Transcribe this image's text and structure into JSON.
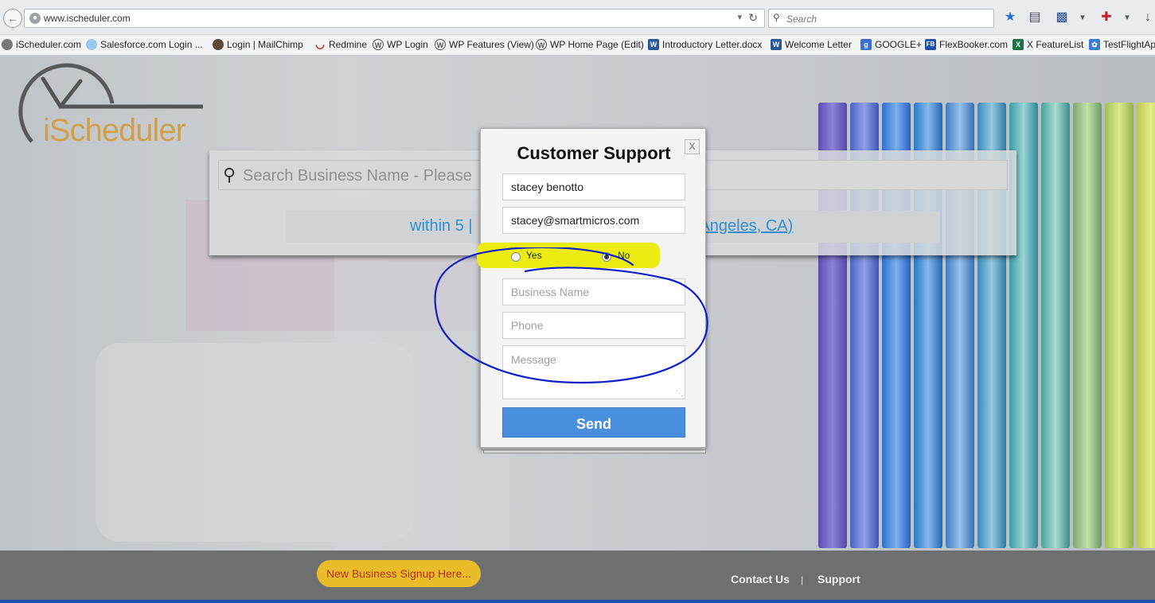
{
  "browser": {
    "url": "www.ischeduler.com",
    "search_placeholder": "Search",
    "bookmarks": [
      {
        "label": "iScheduler.com",
        "icon": "clock-icon"
      },
      {
        "label": "Salesforce.com Login ...",
        "icon": "cloud-icon"
      },
      {
        "label": "Login | MailChimp",
        "icon": "chimp-icon"
      },
      {
        "label": "Redmine",
        "icon": "redmine-icon"
      },
      {
        "label": "WP Login",
        "icon": "wordpress-icon"
      },
      {
        "label": "WP Features (View)",
        "icon": "wordpress-icon"
      },
      {
        "label": "WP Home Page (Edit)",
        "icon": "wordpress-icon"
      },
      {
        "label": "Introductory Letter.docx",
        "icon": "word-icon"
      },
      {
        "label": "Welcome Letter",
        "icon": "word-icon"
      },
      {
        "label": "GOOGLE+",
        "icon": "google-icon"
      },
      {
        "label": "FlexBooker.com",
        "icon": "flexbooker-icon"
      },
      {
        "label": "X FeatureList",
        "icon": "excel-icon"
      },
      {
        "label": "TestFlightAp",
        "icon": "testflight-icon"
      }
    ]
  },
  "site": {
    "logo_text": "iScheduler",
    "search_placeholder": "Search Business Name - Please",
    "radius_text": "within 5 |",
    "location_text": "s Angeles, CA)",
    "footer": {
      "signup_label": "New Business Signup Here...",
      "contact_label": "Contact Us",
      "separator": "|",
      "support_label": "Support"
    }
  },
  "modal": {
    "title": "Customer Support",
    "close_label": "X",
    "name_value": "stacey benotto",
    "email_value": "stacey@smartmicros.com",
    "radio_yes_label": "Yes",
    "radio_no_label": "No",
    "radio_selected": "No",
    "business_placeholder": "Business Name",
    "phone_placeholder": "Phone",
    "message_placeholder": "Message",
    "send_label": "Send"
  },
  "colors": {
    "send_button": "#4a8fde",
    "signup_button": "#e9bc2a",
    "link_blue": "#2f8fcf",
    "annotation_ink": "#1020c8",
    "highlight": "#ecec12"
  }
}
